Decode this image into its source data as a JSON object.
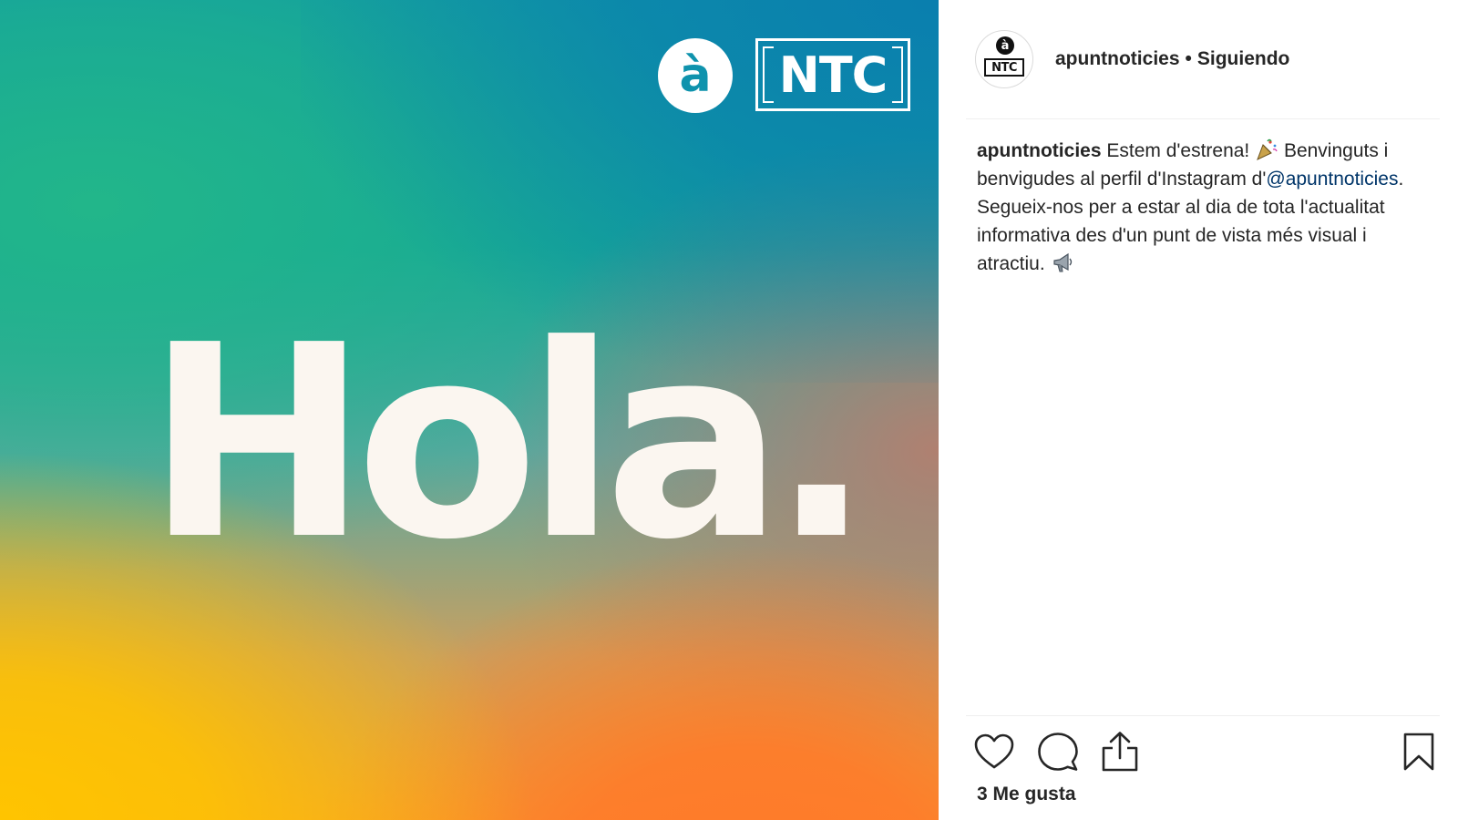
{
  "image": {
    "logo_a_text": "à",
    "logo_ntc_text": "NTC",
    "headline": "Hola."
  },
  "header": {
    "avatar_a": "à",
    "avatar_ntc": "NTC",
    "username": "apuntnoticies",
    "separator": "•",
    "follow_status": "Siguiendo"
  },
  "caption": {
    "username": "apuntnoticies",
    "text_before_mention": " Estem d'estrena! ",
    "text_after_party": " Benvinguts i benvigudes al perfil d'Instagram d'",
    "mention": "@apuntnoticies",
    "text_after_mention": ". Segueix-nos per a estar al dia de tota l'actualitat informativa des d'un punt de vista més visual i atractiu. ",
    "emoji_1": "party-popper-icon",
    "emoji_2": "loudspeaker-icon"
  },
  "actions": {
    "icons": [
      "heart-icon",
      "comment-icon",
      "share-icon",
      "bookmark-icon"
    ]
  },
  "likes": {
    "text": "3 Me gusta"
  },
  "colors": {
    "text": "#262626",
    "mention": "#003569",
    "divider": "#efefef",
    "logo_teal": "#0f93ad"
  }
}
